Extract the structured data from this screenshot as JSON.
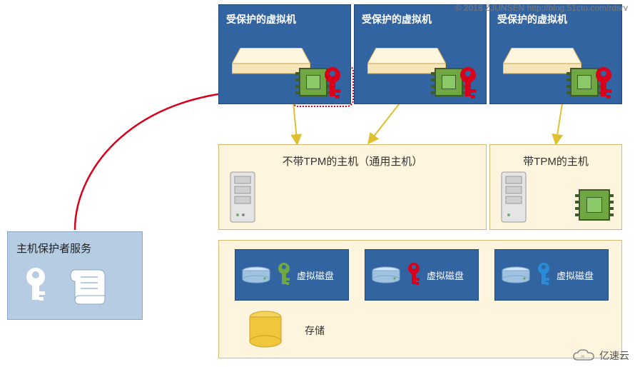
{
  "watermark": "© 2018 ZJUNSEN http://blog.51cto.com/rdsrv",
  "vms": [
    {
      "title": "受保护的虚拟机"
    },
    {
      "title": "受保护的虚拟机"
    },
    {
      "title": "受保护的虚拟机"
    }
  ],
  "hosts": {
    "without_tpm": "不带TPM的主机（通用主机）",
    "with_tpm": "带TPM的主机"
  },
  "disks": [
    {
      "label": "虚拟磁盘",
      "key_color": "#6fa843"
    },
    {
      "label": "虚拟磁盘",
      "key_color": "#d9001b"
    },
    {
      "label": "虚拟磁盘",
      "key_color": "#2a8cd6"
    }
  ],
  "storage_label": "存储",
  "guardian": {
    "title": "主机保护者服务"
  },
  "footer_brand": "亿速云"
}
